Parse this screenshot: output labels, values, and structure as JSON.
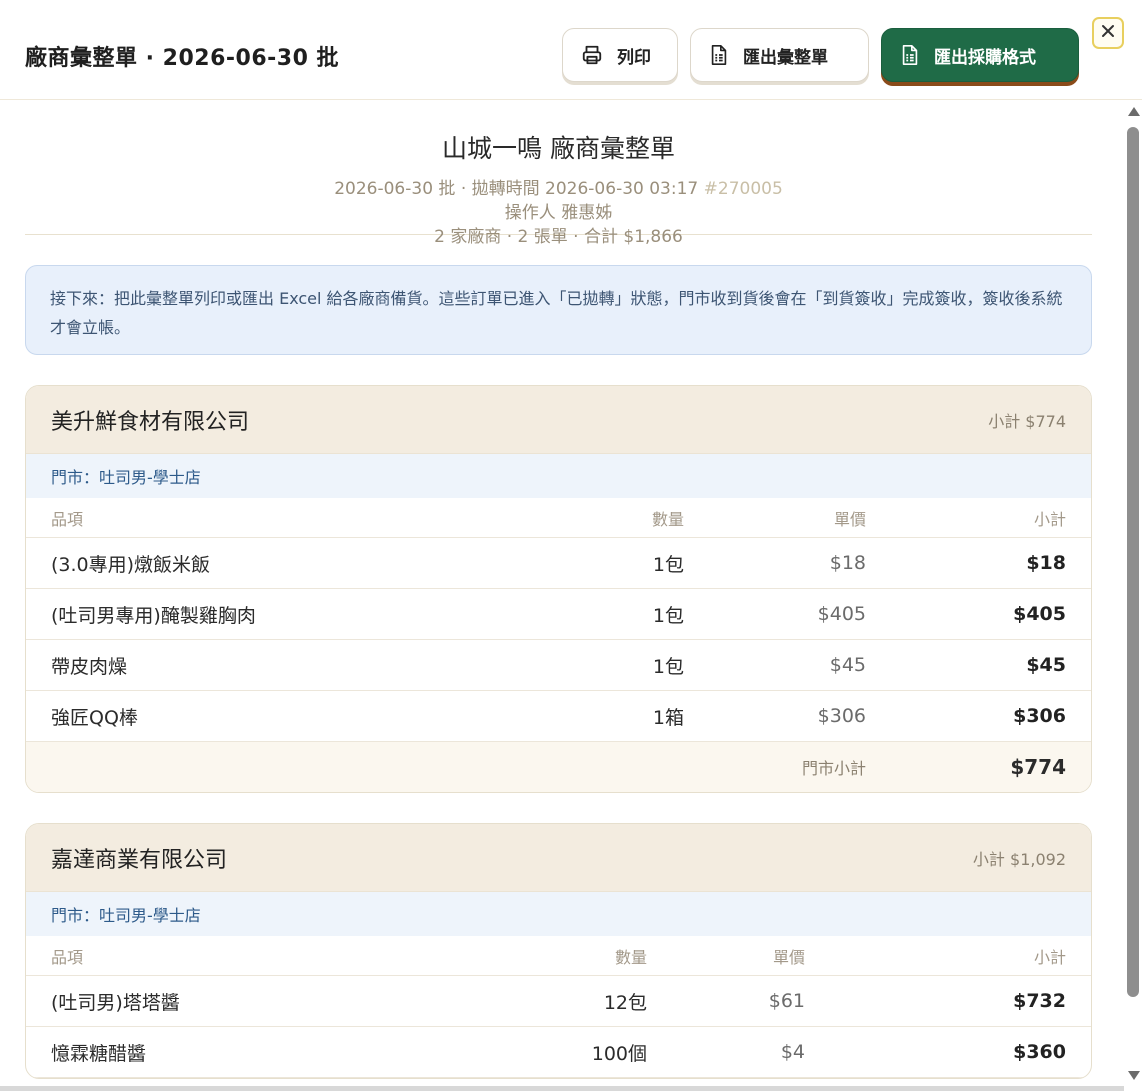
{
  "header": {
    "title": "廠商彙整單 · 2026-06-30 批",
    "buttons": {
      "print": "列印",
      "export_summary": "匯出彙整單",
      "export_purchase": "匯出採購格式"
    },
    "close_icon": "close-icon"
  },
  "document": {
    "title": "山城一鳴 廠商彙整單",
    "meta_batch": "2026-06-30 批 · 拋轉時間 2026-06-30 03:17",
    "meta_order_no": "#270005",
    "meta_operator": "操作人 雅惠姊",
    "meta_summary": "2 家廠商 · 2 張單 · 合計 $1,866"
  },
  "notice": "接下來：把此彙整單列印或匯出 Excel 給各廠商備貨。這些訂單已進入「已拋轉」狀態，門市收到貨後會在「到貨簽收」完成簽收，簽收後系統才會立帳。",
  "columns": {
    "item": "品項",
    "qty": "數量",
    "price": "單價",
    "subtotal": "小計"
  },
  "vendors": [
    {
      "name": "美升鮮食材有限公司",
      "subtotal": "小計 $774",
      "store": "門市：吐司男-學士店",
      "rows": [
        {
          "item": "(3.0專用)燉飯米飯",
          "qty": "1包",
          "price": "$18",
          "subtotal": "$18"
        },
        {
          "item": "(吐司男專用)醃製雞胸肉",
          "qty": "1包",
          "price": "$405",
          "subtotal": "$405"
        },
        {
          "item": "帶皮肉燥",
          "qty": "1包",
          "price": "$45",
          "subtotal": "$45"
        },
        {
          "item": "強匠QQ棒",
          "qty": "1箱",
          "price": "$306",
          "subtotal": "$306"
        }
      ],
      "store_total_label": "門市小計",
      "store_total": "$774"
    },
    {
      "name": "嘉達商業有限公司",
      "subtotal": "小計 $1,092",
      "store": "門市：吐司男-學士店",
      "rows": [
        {
          "item": "(吐司男)塔塔醬",
          "qty": "12包",
          "price": "$61",
          "subtotal": "$732"
        },
        {
          "item": "憶霖糖醋醬",
          "qty": "100個",
          "price": "$4",
          "subtotal": "$360"
        }
      ]
    }
  ],
  "colors": {
    "primary": "#1f6b47",
    "header_bg": "#f3ece0",
    "notice_bg": "#e8f0fb",
    "store_text": "#2d5a8a"
  }
}
